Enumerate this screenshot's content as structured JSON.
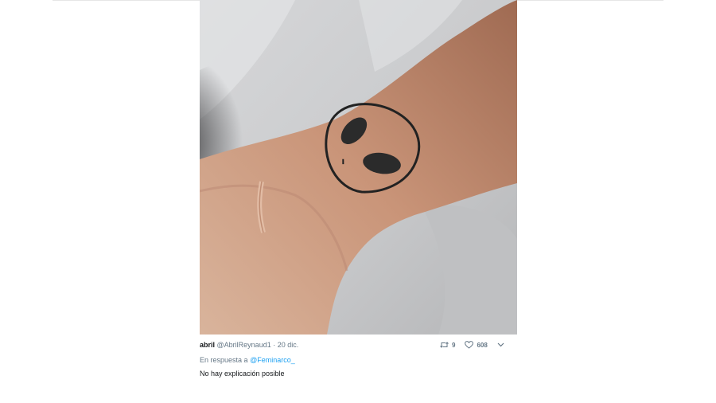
{
  "tweet": {
    "author_name": "abril",
    "author_handle": "@AbrilReynaud1",
    "separator": "·",
    "date": "20 dic.",
    "reply_prefix": "En respuesta a",
    "reply_to": "@Feminarco_",
    "text": "No hay explicación posible",
    "retweets": "9",
    "likes": "608"
  },
  "icons": {
    "retweet": "retweet-icon",
    "like": "heart-icon",
    "more": "chevron-down-icon"
  },
  "colors": {
    "accent": "#1da1f2",
    "text": "#14171a",
    "muted": "#657786"
  }
}
